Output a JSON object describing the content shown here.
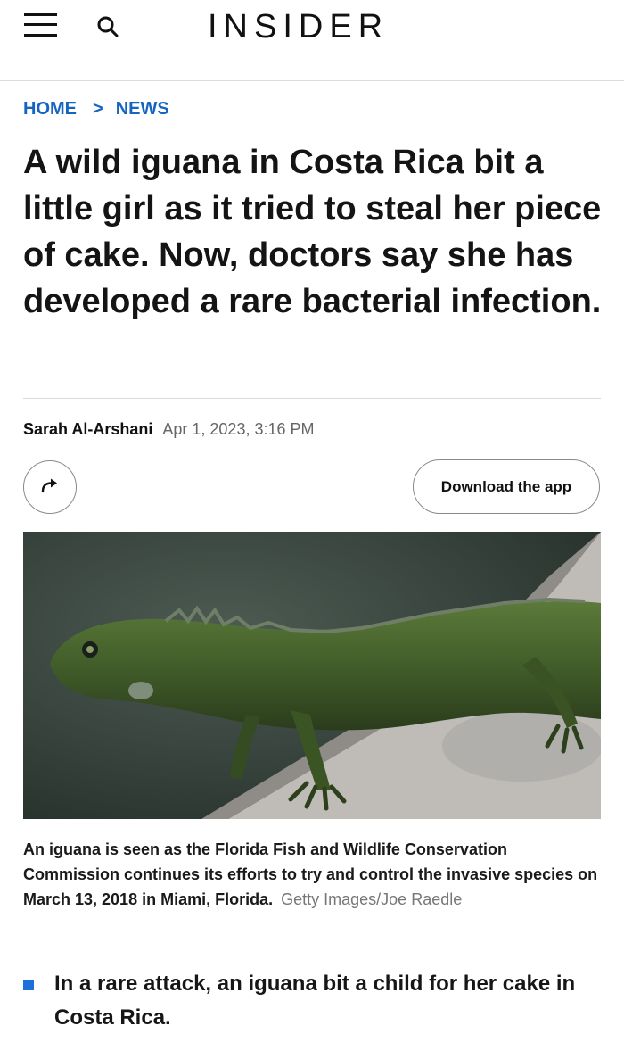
{
  "header": {
    "logo": "INSIDER",
    "menu_icon": "hamburger-menu-icon",
    "search_icon": "search-icon"
  },
  "breadcrumb": {
    "home": "HOME",
    "separator": ">",
    "section": "NEWS"
  },
  "article": {
    "headline": "A wild iguana in Costa Rica bit a little girl as it tried to steal her piece of cake. Now, doctors say she has developed a rare bacterial infection.",
    "author": "Sarah Al-Arshani",
    "date": "Apr 1, 2023, 3:16 PM",
    "share_icon": "share-arrow-icon",
    "download_app_label": "Download the app",
    "image_caption": "An iguana is seen as the Florida Fish and Wildlife Conservation Commission continues its efforts to try and control the invasive species on March 13, 2018 in Miami, Florida.",
    "image_credit": "Getty Images/Joe Raedle",
    "key_points": [
      "In a rare attack, an iguana bit a child for her cake in Costa Rica."
    ]
  },
  "colors": {
    "link_blue": "#1565c0",
    "bullet_blue": "#1e6fd9",
    "text": "#141414",
    "muted": "#666666"
  }
}
